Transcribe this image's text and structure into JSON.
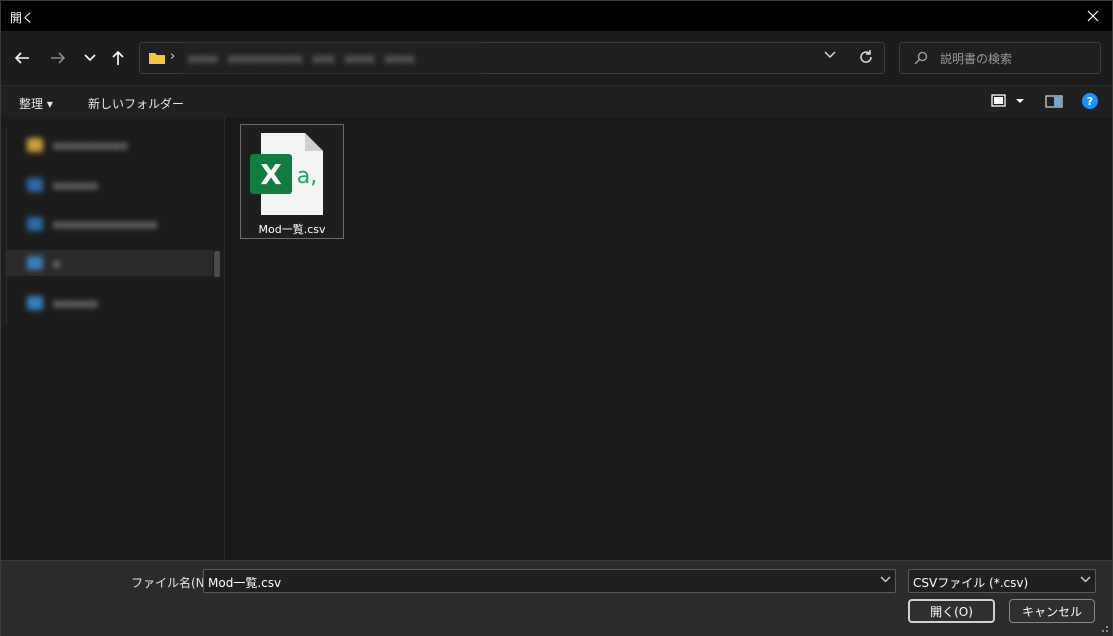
{
  "window": {
    "title": "開く"
  },
  "nav": {
    "back_icon": "arrow-left-icon",
    "forward_icon": "arrow-right-icon",
    "history_icon": "chevron-down-icon",
    "up_icon": "arrow-up-icon"
  },
  "address": {
    "separator": "›"
  },
  "search": {
    "placeholder": "説明書の検索"
  },
  "commandbar": {
    "organize": "整理 ▾",
    "new_folder": "新しいフォルダー"
  },
  "files": [
    {
      "name": "Mod一覧.csv",
      "icon": "excel-csv-icon"
    }
  ],
  "footer": {
    "filename_label": "ファイル名(N):",
    "filename_value": "Mod一覧.csv",
    "filetype_value": "CSVファイル (*.csv)",
    "open_button": "開く(O)",
    "cancel_button": "キャンセル"
  },
  "colors": {
    "excel_green": "#107c41",
    "accent_blue": "#1e90ff",
    "folder_yellow": "#f5c542"
  }
}
